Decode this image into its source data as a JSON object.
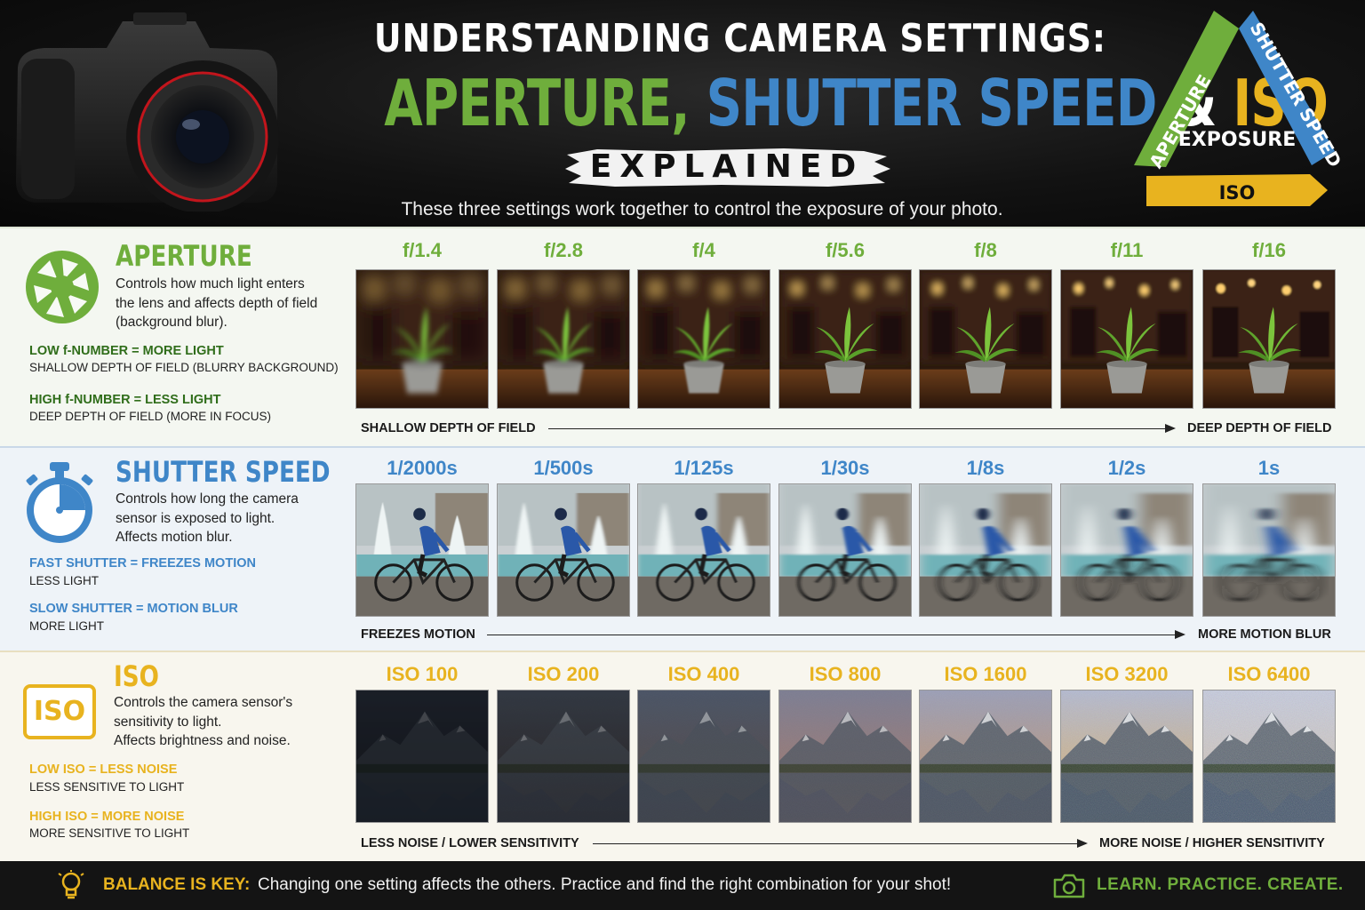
{
  "header": {
    "title_line1": "UNDERSTANDING CAMERA SETTINGS:",
    "title_aperture": "APERTURE,",
    "title_shutter": "SHUTTER SPEED",
    "title_amp": "&",
    "title_iso": "ISO",
    "explained": "EXPLAINED",
    "subtitle": "These three settings work together to control the exposure of your photo."
  },
  "triangle": {
    "left_side": "APERTURE",
    "right_side": "SHUTTER SPEED",
    "bottom": "ISO",
    "center": "EXPOSURE"
  },
  "colors": {
    "aperture": "#6fae3c",
    "shutter": "#3f86c8",
    "iso": "#e8b31f"
  },
  "aperture": {
    "title": "APERTURE",
    "icon": "aperture-icon",
    "desc": [
      "Controls how much light enters",
      "the lens and affects depth of field",
      "(background blur)."
    ],
    "rule1_a": "LOW f-NUMBER = MORE LIGHT",
    "rule1_b": "SHALLOW DEPTH OF FIELD (BLURRY BACKGROUND)",
    "rule2_a": "HIGH f-NUMBER = LESS LIGHT",
    "rule2_b": "DEEP DEPTH OF FIELD (MORE IN FOCUS)",
    "values": [
      "f/1.4",
      "f/2.8",
      "f/4",
      "f/5.6",
      "f/8",
      "f/11",
      "f/16"
    ],
    "axis_left": "SHALLOW DEPTH OF FIELD",
    "axis_right": "DEEP DEPTH OF FIELD"
  },
  "shutter": {
    "title": "SHUTTER SPEED",
    "icon": "stopwatch-icon",
    "desc": [
      "Controls how long the camera",
      "sensor is exposed to light.",
      "Affects motion blur."
    ],
    "rule1_a": "FAST SHUTTER = FREEZES MOTION",
    "rule1_b": "LESS LIGHT",
    "rule2_a": "SLOW SHUTTER = MOTION BLUR",
    "rule2_b": "MORE LIGHT",
    "values": [
      "1/2000s",
      "1/500s",
      "1/125s",
      "1/30s",
      "1/8s",
      "1/2s",
      "1s"
    ],
    "axis_left": "FREEZES MOTION",
    "axis_right": "MORE MOTION BLUR"
  },
  "iso": {
    "title": "ISO",
    "icon_text": "ISO",
    "desc": [
      "Controls the camera sensor's",
      "sensitivity to light.",
      "Affects brightness and noise."
    ],
    "rule1_a": "LOW ISO = LESS NOISE",
    "rule1_b": "LESS SENSITIVE TO LIGHT",
    "rule2_a": "HIGH ISO = MORE NOISE",
    "rule2_b": "MORE SENSITIVE TO LIGHT",
    "values": [
      "ISO 100",
      "ISO 200",
      "ISO 400",
      "ISO 800",
      "ISO 1600",
      "ISO 3200",
      "ISO 6400"
    ],
    "axis_left": "LESS NOISE / LOWER SENSITIVITY",
    "axis_right": "MORE NOISE / HIGHER SENSITIVITY"
  },
  "footer": {
    "key": "BALANCE IS KEY:",
    "text": "Changing one setting affects the others. Practice and find the right combination for your shot!",
    "cta": "LEARN. PRACTICE. CREATE.",
    "bulb_icon": "lightbulb-icon",
    "camera_icon": "camera-icon"
  }
}
